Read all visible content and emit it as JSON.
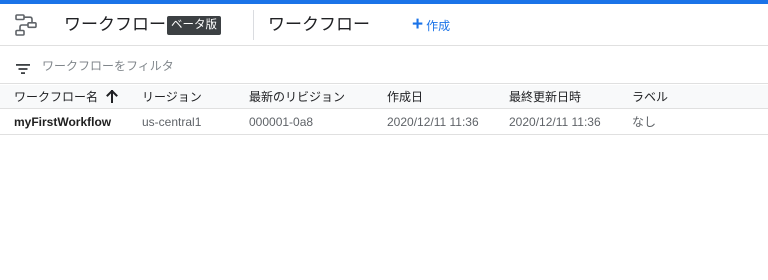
{
  "accent_color": "#1a73e8",
  "header": {
    "product_title": "ワークフロー",
    "beta_badge": "ベータ版",
    "page_title": "ワークフロー",
    "create_label": "作成",
    "icons": [
      "workflows-icon",
      "plus-icon"
    ]
  },
  "filter": {
    "placeholder": "ワークフローをフィルタ",
    "value": "",
    "icon": "filter-icon"
  },
  "table": {
    "columns": [
      "ワークフロー名",
      "リージョン",
      "最新のリビジョン",
      "作成日",
      "最終更新日時",
      "ラベル"
    ],
    "sort_column": "ワークフロー名",
    "sort_direction": "ascending",
    "rows": [
      {
        "name": "myFirstWorkflow",
        "region": "us-central1",
        "revision": "000001-0a8",
        "created": "2020/12/11 11:36",
        "updated": "2020/12/11 11:36",
        "labels": "なし"
      }
    ]
  }
}
